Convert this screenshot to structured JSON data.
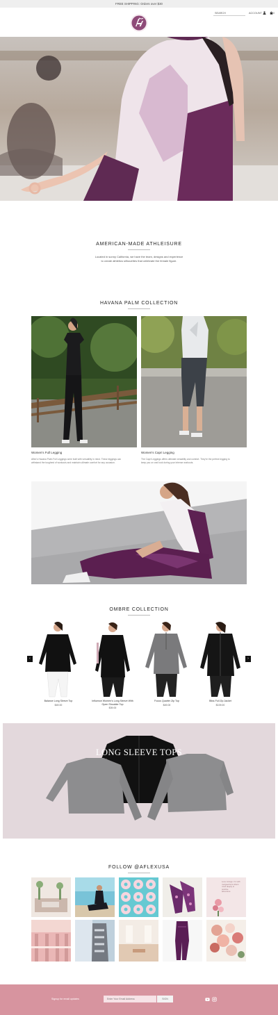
{
  "promo": {
    "text": "FREE SHIPPING: Orders over $30"
  },
  "header": {
    "search_placeholder": "SEARCH",
    "account_label": "ACCOUNT",
    "cart_count": "0",
    "icons": {
      "logo": "aflex-logo",
      "account": "user-icon",
      "cart": "bag-icon"
    }
  },
  "intro": {
    "title": "AMERICAN-MADE ATHLEISURE",
    "text_line1": "Located in sunny California, we have the team, designs and experience",
    "text_line2": "to create athletics silhouettes that celebrate the female figure."
  },
  "havana": {
    "title": "HAVANA PALM COLLECTION",
    "products": [
      {
        "title": "Women's Full Legging",
        "desc1": "Aflex's Havana Palm Full Leggings were built with versatility in mind. These leggings can",
        "desc2": "withstand the toughest of workouts and maintain ultimate comfort for any occasion."
      },
      {
        "title": "Women's Capri Legging",
        "desc1": "The Capri Leggings offers ultimate versatility and comfort. They're the perfect legging to",
        "desc2": "keep you on and look during your intense workouts."
      }
    ]
  },
  "ombre": {
    "title": "OMBRE COLLECTION",
    "products": [
      {
        "name_line1": "Balance Long Sleeve Top",
        "name_line2": "",
        "price": "$49.00"
      },
      {
        "name_line1": "Influence Women's Long Sleeve With",
        "name_line2": "Open Shoulder Top",
        "price": "$39.00"
      },
      {
        "name_line1": "Focus Quarter Zip Top",
        "name_line2": "",
        "price": "$49.00"
      },
      {
        "name_line1": "Bliss Full Zip Jacket",
        "name_line2": "",
        "price": "$109.00"
      }
    ],
    "arrows": {
      "prev": "‹",
      "next": "›"
    }
  },
  "banner": {
    "title": "LONG SLEEVE TOPS"
  },
  "instagram": {
    "title": "FOLLOW @AFLEXUSA",
    "quote_line1": "Love Linings. I'm with",
    "quote_line2": "marguerita & others",
    "quote_line3": "mind deeply to",
    "quote_line4": "positive",
    "quote_line5": "adventure"
  },
  "footer": {
    "newsletter_text": "Signup for email updates",
    "email_placeholder": "Enter Your Email Address",
    "submit_label": "SIGN",
    "icons": {
      "youtube": "youtube-icon",
      "instagram": "instagram-icon"
    }
  },
  "colors": {
    "accent_pink": "#d7949f",
    "logo_purple": "#8e4a78",
    "banner_bg": "#e3d8dc"
  }
}
